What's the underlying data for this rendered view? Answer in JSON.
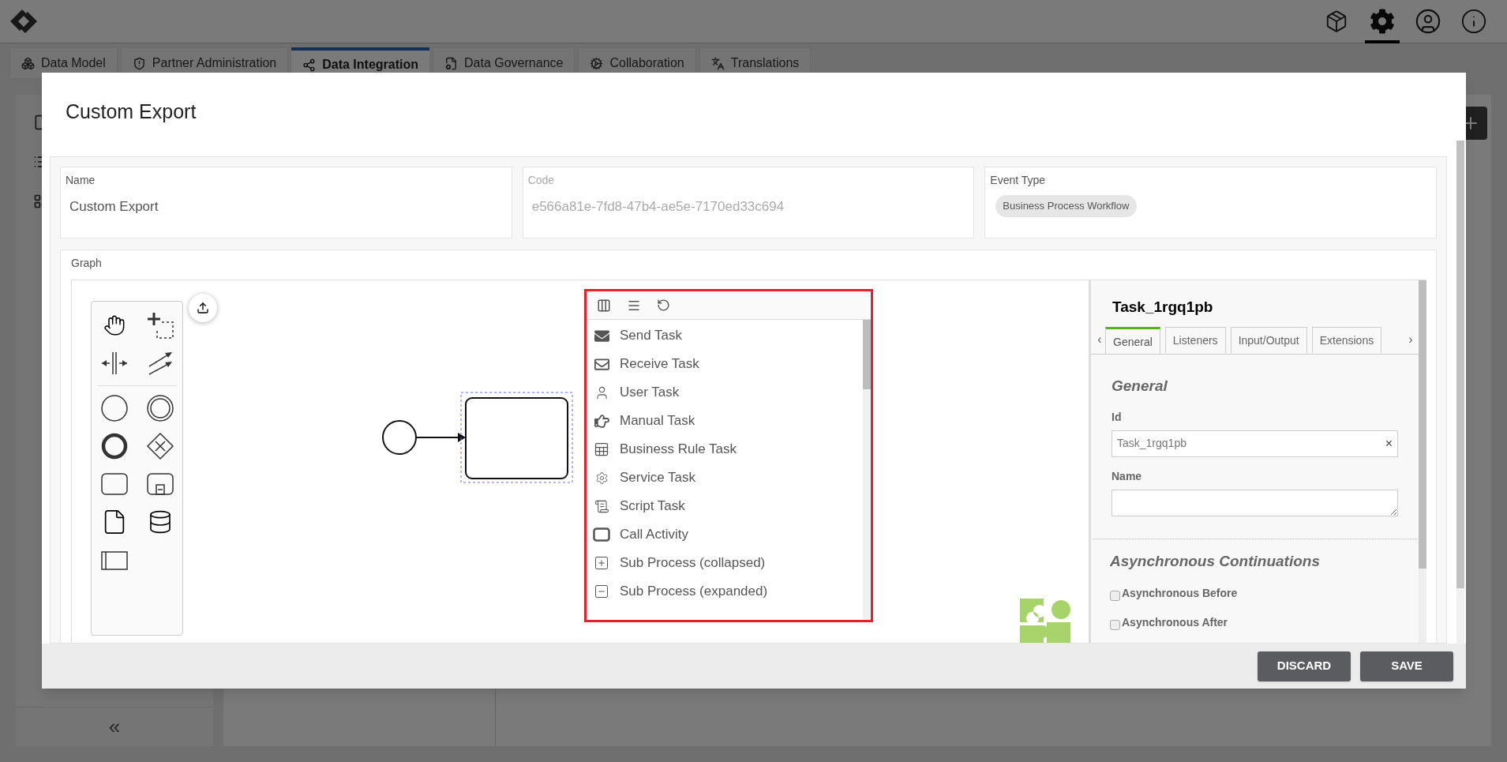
{
  "app_bar": {
    "icons": [
      {
        "kind": "package",
        "selected": false
      },
      {
        "kind": "settings",
        "selected": true
      },
      {
        "kind": "user",
        "selected": false
      },
      {
        "kind": "info",
        "selected": false
      }
    ]
  },
  "main_tabs": [
    {
      "label": "Data Model",
      "kind": "model",
      "selected": false
    },
    {
      "label": "Partner Administration",
      "kind": "partner",
      "selected": false
    },
    {
      "label": "Data Integration",
      "kind": "integration",
      "selected": true
    },
    {
      "label": "Data Governance",
      "kind": "governance",
      "selected": false
    },
    {
      "label": "Collaboration",
      "kind": "collaboration",
      "selected": false
    },
    {
      "label": "Translations",
      "kind": "translations",
      "selected": false
    }
  ],
  "sidebar": {
    "collapse": "«"
  },
  "dialog": {
    "title": "Custom Export",
    "fields": [
      {
        "kind": "text",
        "label": "Name",
        "value": "Custom Export",
        "disabled": false
      },
      {
        "kind": "text",
        "label": "Code",
        "value": "e566a81e-7fd8-47b4-ae5e-7170ed33c694",
        "disabled": true
      },
      {
        "kind": "tag",
        "label": "Event Type",
        "value": "Business Process Workflow",
        "disabled": false
      }
    ],
    "graph": {
      "label": "Graph",
      "popup_menu": {
        "items": [
          {
            "label": "Send Task",
            "kind": "send"
          },
          {
            "label": "Receive Task",
            "kind": "receive"
          },
          {
            "label": "User Task",
            "kind": "user"
          },
          {
            "label": "Manual Task",
            "kind": "manual"
          },
          {
            "label": "Business Rule Task",
            "kind": "rule"
          },
          {
            "label": "Service Task",
            "kind": "service"
          },
          {
            "label": "Script Task",
            "kind": "script"
          },
          {
            "label": "Call Activity",
            "kind": "call"
          },
          {
            "label": "Sub Process (collapsed)",
            "kind": "collapsed"
          },
          {
            "label": "Sub Process (expanded)",
            "kind": "expanded"
          }
        ]
      },
      "properties": {
        "title": "Task_1rgq1pb",
        "tab_prev": "‹",
        "tab_next": "›",
        "tabs": [
          {
            "label": "General",
            "selected": true
          },
          {
            "label": "Listeners",
            "selected": false
          },
          {
            "label": "Input/Output",
            "selected": false
          },
          {
            "label": "Extensions",
            "selected": false
          }
        ],
        "sections": [
          {
            "kind": "fields",
            "title": "General",
            "fields": [
              {
                "kind": "input",
                "label": "Id",
                "value": "Task_1rgq1pb",
                "clear": "×"
              },
              {
                "kind": "textarea",
                "label": "Name"
              }
            ]
          },
          {
            "kind": "checks",
            "title": "Asynchronous Continuations",
            "options": [
              {
                "label": "Asynchronous Before",
                "checked": false
              },
              {
                "label": "Asynchronous After",
                "checked": false
              }
            ]
          }
        ]
      }
    },
    "buttons": [
      {
        "label": "DISCARD"
      },
      {
        "label": "SAVE"
      }
    ]
  }
}
